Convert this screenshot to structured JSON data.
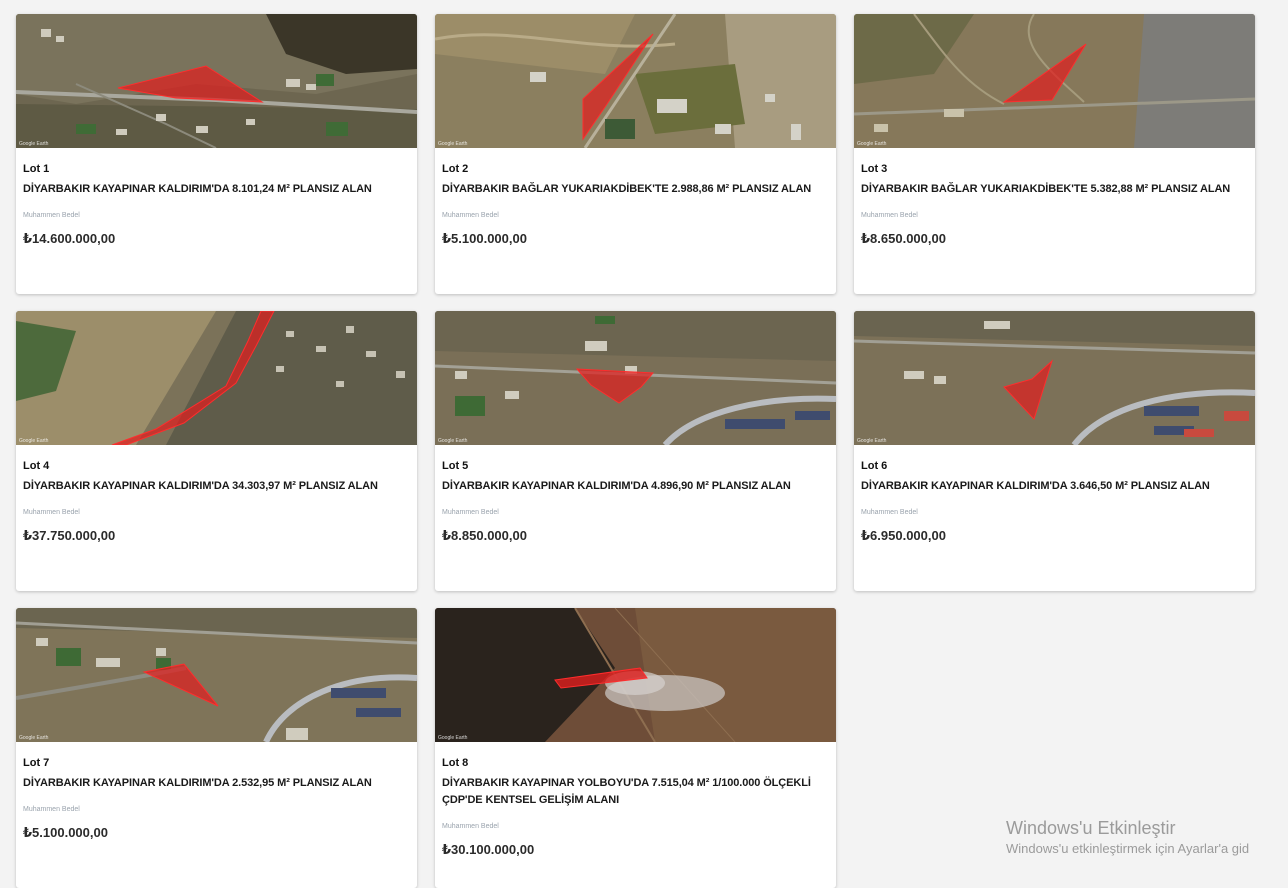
{
  "price_label": "Muhammen Bedel",
  "map_credit": "Google Earth",
  "lots": [
    {
      "lot": "Lot 1",
      "title": "DİYARBAKIR KAYAPINAR KALDIRIM'DA 8.101,24 M² PLANSIZ ALAN",
      "price": "₺14.600.000,00"
    },
    {
      "lot": "Lot 2",
      "title": "DİYARBAKIR BAĞLAR YUKARIAKDİBEK'TE 2.988,86 M² PLANSIZ ALAN",
      "price": "₺5.100.000,00"
    },
    {
      "lot": "Lot 3",
      "title": "DİYARBAKIR BAĞLAR YUKARIAKDİBEK'TE 5.382,88 M² PLANSIZ ALAN",
      "price": "₺8.650.000,00"
    },
    {
      "lot": "Lot 4",
      "title": "DİYARBAKIR KAYAPINAR KALDIRIM'DA 34.303,97 M² PLANSIZ ALAN",
      "price": "₺37.750.000,00"
    },
    {
      "lot": "Lot 5",
      "title": "DİYARBAKIR KAYAPINAR KALDIRIM'DA 4.896,90 M² PLANSIZ ALAN",
      "price": "₺8.850.000,00"
    },
    {
      "lot": "Lot 6",
      "title": "DİYARBAKIR KAYAPINAR KALDIRIM'DA 3.646,50 M² PLANSIZ ALAN",
      "price": "₺6.950.000,00"
    },
    {
      "lot": "Lot 7",
      "title": "DİYARBAKIR KAYAPINAR KALDIRIM'DA 2.532,95 M² PLANSIZ ALAN",
      "price": "₺5.100.000,00"
    },
    {
      "lot": "Lot 8",
      "title": "DİYARBAKIR KAYAPINAR YOLBOYU'DA 7.515,04 M² 1/100.000 ÖLÇEKLİ ÇDP'DE KENTSEL GELİŞİM ALANI",
      "price": "₺30.100.000,00"
    }
  ],
  "windows_watermark": {
    "title": "Windows'u Etkinleştir",
    "subtitle": "Windows'u etkinleştirmek için Ayarlar'a gid"
  },
  "colors": {
    "page_bg": "#f3f3f3",
    "card_bg": "#ffffff",
    "parcel_fill": "#e01e1e",
    "price_label": "#9aa3ad"
  }
}
